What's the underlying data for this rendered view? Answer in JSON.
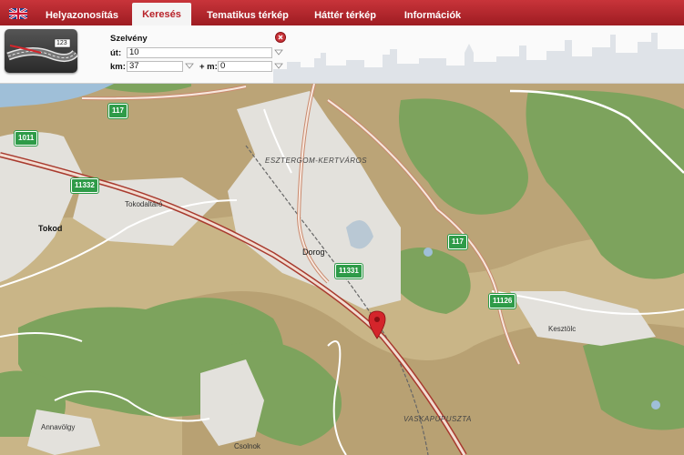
{
  "nav": {
    "tabs": [
      {
        "label": "Helyazonosítás",
        "active": false
      },
      {
        "label": "Keresés",
        "active": true
      },
      {
        "label": "Tematikus térkép",
        "active": false
      },
      {
        "label": "Háttér térkép",
        "active": false
      },
      {
        "label": "Információk",
        "active": false
      }
    ],
    "language_icon": "uk-flag-icon"
  },
  "search": {
    "thumbnail_badge": "123",
    "title": "Szelvény",
    "ut_label": "út:",
    "ut_value": "10",
    "km_label": "km:",
    "km_value": "37",
    "m_label": "+ m:",
    "m_value": "0",
    "close_icon": "close-icon"
  },
  "map": {
    "places": [
      "Tokod",
      "Tokodaltáró",
      "ESZTERGOM-KERTVÁROS",
      "Dorog",
      "Kesztölc",
      "VASKAPUPUSZTA",
      "Annavölgy",
      "Csolnok"
    ],
    "road_shields": [
      "117",
      "1011",
      "11332",
      "117",
      "11331",
      "11126"
    ],
    "colors": {
      "shield": "#2e9b48",
      "tab_bar": "#b8232a",
      "marker": "#d4252b"
    }
  }
}
